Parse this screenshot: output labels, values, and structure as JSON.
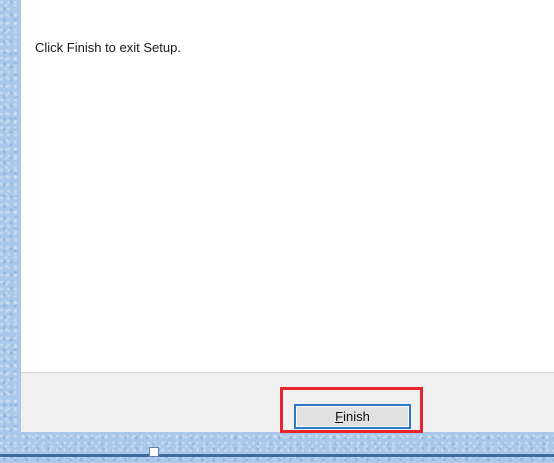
{
  "dialog": {
    "message": "Click Finish to exit Setup."
  },
  "footer": {
    "finish_button": {
      "mnemonic": "F",
      "rest": "inish"
    }
  },
  "colors": {
    "desktop_background": "#a9c8ea",
    "dialog_background": "#ffffff",
    "footer_background": "#f0f0f0",
    "highlight_border": "#e8242c",
    "button_focus_border": "#2a78c8"
  }
}
